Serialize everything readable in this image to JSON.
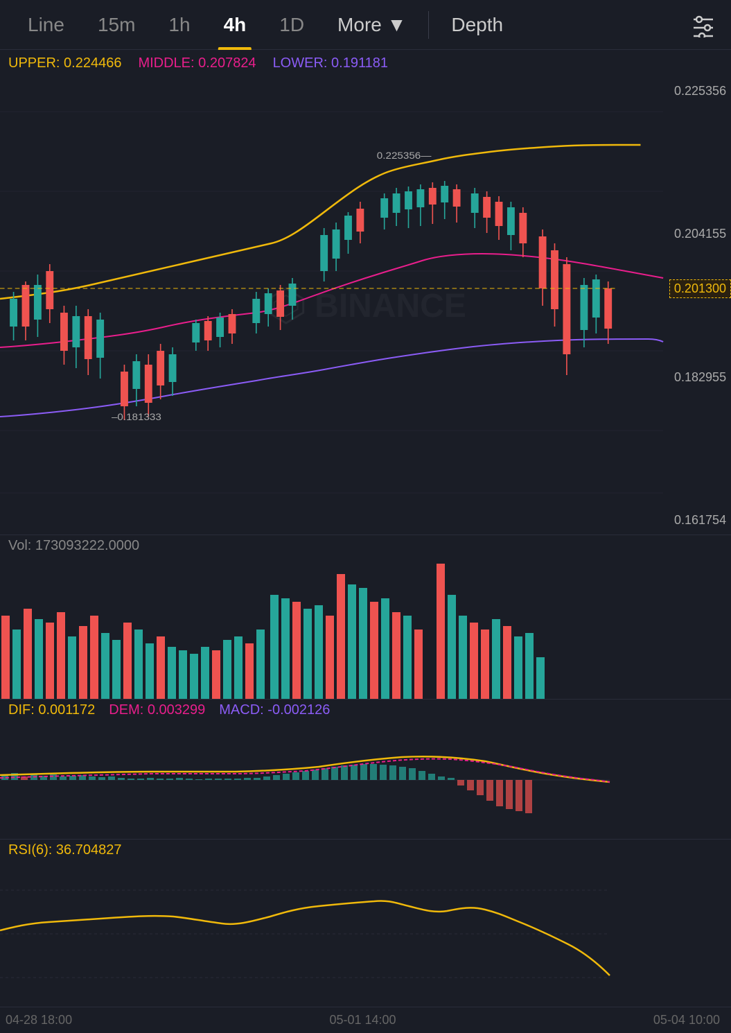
{
  "nav": {
    "items": [
      {
        "label": "Line",
        "active": false
      },
      {
        "label": "15m",
        "active": false
      },
      {
        "label": "1h",
        "active": false
      },
      {
        "label": "4h",
        "active": true
      },
      {
        "label": "1D",
        "active": false
      },
      {
        "label": "More ▼",
        "active": false
      },
      {
        "label": "Depth",
        "active": false
      }
    ],
    "settings_icon": "⊟"
  },
  "bollinger": {
    "upper_label": "UPPER:",
    "upper_value": "0.224466",
    "middle_label": "MIDDLE:",
    "middle_value": "0.207824",
    "lower_label": "LOWER:",
    "lower_value": "0.191181"
  },
  "prices": {
    "top": "0.225356",
    "mid_high": "0.204155",
    "current": "0.201300",
    "mid_low": "0.182955",
    "low": "0.161754",
    "annotation_top": "0.225356–",
    "annotation_mid": "0.181333"
  },
  "volume": {
    "label": "Vol:",
    "value": "173093222.0000"
  },
  "macd": {
    "dif_label": "DIF:",
    "dif_value": "0.001172",
    "dem_label": "DEM:",
    "dem_value": "0.003299",
    "macd_label": "MACD:",
    "macd_value": "-0.002126"
  },
  "rsi": {
    "label": "RSI(6):",
    "value": "36.704827"
  },
  "time_axis": {
    "labels": [
      "04-28 18:00",
      "05-01 14:00",
      "05-04 10:00"
    ]
  }
}
